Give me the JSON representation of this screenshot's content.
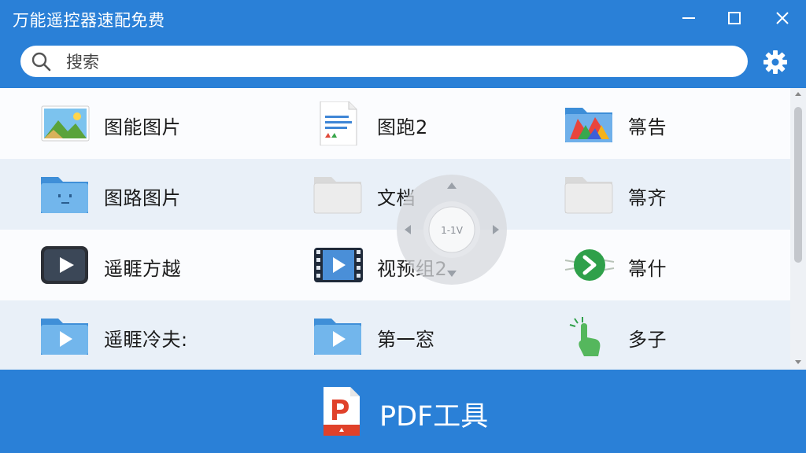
{
  "app": {
    "title": "万能遥控器速配免费"
  },
  "search": {
    "placeholder": "搜索"
  },
  "grid": {
    "rows": [
      [
        {
          "label": "图能图片",
          "icon": "picture-file-icon"
        },
        {
          "label": "图跑2",
          "icon": "document-file-icon"
        },
        {
          "label": "箒告",
          "icon": "media-folder-icon"
        }
      ],
      [
        {
          "label": "图路图片",
          "icon": "blue-folder-icon"
        },
        {
          "label": "文档",
          "icon": "gray-folder-icon"
        },
        {
          "label": "箒齐",
          "icon": "gray-folder-icon"
        }
      ],
      [
        {
          "label": "遥睚方越",
          "icon": "video-player-icon"
        },
        {
          "label": "视预组2",
          "icon": "video-film-icon"
        },
        {
          "label": "箒什",
          "icon": "green-arrow-icon"
        }
      ],
      [
        {
          "label": "遥睚冷夫:",
          "icon": "video-folder-icon"
        },
        {
          "label": "第一窓",
          "icon": "video-folder-icon"
        },
        {
          "label": "多子",
          "icon": "touch-hand-icon"
        }
      ]
    ]
  },
  "remote": {
    "center_text": "1-1V"
  },
  "footer": {
    "label": "PDF工具",
    "icon": "pdf-icon"
  },
  "colors": {
    "accent": "#2a80d7",
    "row_alt": "#e9f0f8"
  }
}
